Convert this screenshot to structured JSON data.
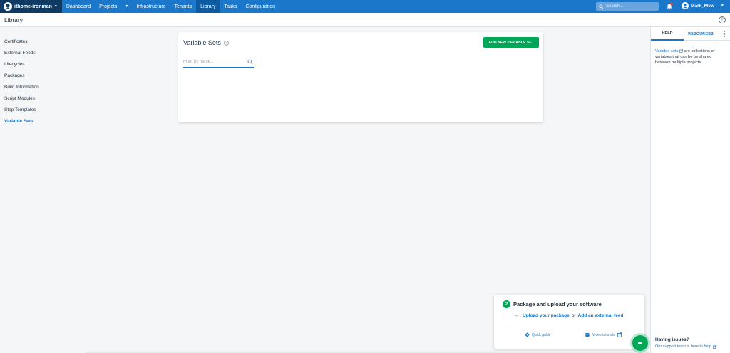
{
  "topnav": {
    "space_name": "ithome-ironman",
    "items": [
      "Dashboard",
      "Projects",
      "Infrastructure",
      "Tenants",
      "Library",
      "Tasks",
      "Configuration"
    ],
    "active": "Library",
    "search_placeholder": "Search...",
    "user_name": "Mark_Mew"
  },
  "header": {
    "title": "Library"
  },
  "sidebar": {
    "items": [
      {
        "label": "Certificates"
      },
      {
        "label": "External Feeds"
      },
      {
        "label": "Lifecycles"
      },
      {
        "label": "Packages"
      },
      {
        "label": "Build Information"
      },
      {
        "label": "Script Modules"
      },
      {
        "label": "Step Templates"
      },
      {
        "label": "Variable Sets"
      }
    ],
    "active": "Variable Sets"
  },
  "main": {
    "title": "Variable Sets",
    "add_button": "ADD NEW VARIABLE SET",
    "filter_placeholder": "Filter by name..."
  },
  "help_panel": {
    "tabs": [
      "HELP",
      "RESOURCES"
    ],
    "link_text": "Variable sets",
    "body_text": "are collections of variables that can be be shared between multiple projects.",
    "issues_heading": "Having issues?",
    "issues_link": "Our support team is here to help"
  },
  "onboarding": {
    "step": "2",
    "title": "Package and upload your software",
    "link1": "Upload your package",
    "or_text": "or",
    "link2": "Add an external feed",
    "quick_guide": "Quick guide",
    "video_tutorials": "Video tutorials"
  },
  "colors": {
    "nav_blue": "#1a77ca",
    "space_dark": "#0e3a63",
    "accent_green": "#00a757"
  }
}
